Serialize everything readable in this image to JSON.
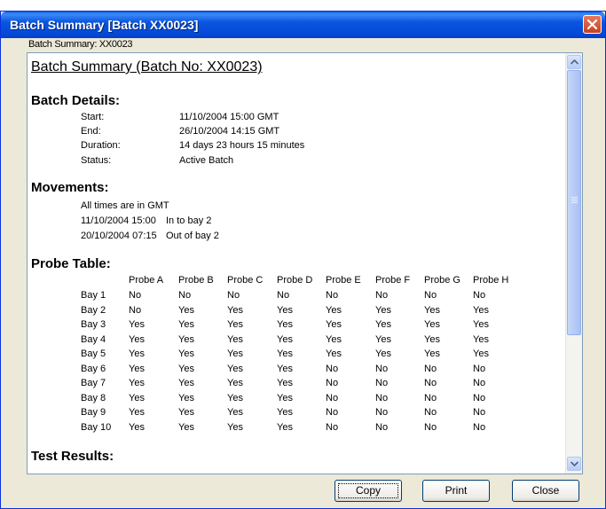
{
  "window": {
    "title": "Batch Summary [Batch XX0023]"
  },
  "group_label": "Batch Summary: XX0023",
  "report": {
    "heading": "Batch Summary (Batch No: XX0023)",
    "batch_details": {
      "title": "Batch Details:",
      "rows": [
        {
          "label": "Start:",
          "value": "11/10/2004 15:00 GMT"
        },
        {
          "label": "End:",
          "value": "26/10/2004 14:15 GMT"
        },
        {
          "label": "Duration:",
          "value": "14 days 23 hours 15 minutes"
        },
        {
          "label": "Status:",
          "value": "Active Batch"
        }
      ]
    },
    "movements": {
      "title": "Movements:",
      "note": "All times are in GMT",
      "rows": [
        {
          "time": "11/10/2004 15:00",
          "event": "In to bay 2"
        },
        {
          "time": "20/10/2004 07:15",
          "event": "Out of bay 2"
        }
      ]
    },
    "probe_table": {
      "title": "Probe Table:",
      "columns": [
        "Probe A",
        "Probe B",
        "Probe C",
        "Probe D",
        "Probe E",
        "Probe F",
        "Probe G",
        "Probe H"
      ],
      "rows": [
        {
          "bay": "Bay 1",
          "cells": [
            "No",
            "No",
            "No",
            "No",
            "No",
            "No",
            "No",
            "No"
          ]
        },
        {
          "bay": "Bay 2",
          "cells": [
            "No",
            "Yes",
            "Yes",
            "Yes",
            "Yes",
            "Yes",
            "Yes",
            "Yes"
          ]
        },
        {
          "bay": "Bay 3",
          "cells": [
            "Yes",
            "Yes",
            "Yes",
            "Yes",
            "Yes",
            "Yes",
            "Yes",
            "Yes"
          ]
        },
        {
          "bay": "Bay 4",
          "cells": [
            "Yes",
            "Yes",
            "Yes",
            "Yes",
            "Yes",
            "Yes",
            "Yes",
            "Yes"
          ]
        },
        {
          "bay": "Bay 5",
          "cells": [
            "Yes",
            "Yes",
            "Yes",
            "Yes",
            "Yes",
            "Yes",
            "Yes",
            "Yes"
          ]
        },
        {
          "bay": "Bay 6",
          "cells": [
            "Yes",
            "Yes",
            "Yes",
            "Yes",
            "No",
            "No",
            "No",
            "No"
          ]
        },
        {
          "bay": "Bay 7",
          "cells": [
            "Yes",
            "Yes",
            "Yes",
            "Yes",
            "No",
            "No",
            "No",
            "No"
          ]
        },
        {
          "bay": "Bay 8",
          "cells": [
            "Yes",
            "Yes",
            "Yes",
            "Yes",
            "No",
            "No",
            "No",
            "No"
          ]
        },
        {
          "bay": "Bay 9",
          "cells": [
            "Yes",
            "Yes",
            "Yes",
            "Yes",
            "No",
            "No",
            "No",
            "No"
          ]
        },
        {
          "bay": "Bay 10",
          "cells": [
            "Yes",
            "Yes",
            "Yes",
            "Yes",
            "No",
            "No",
            "No",
            "No"
          ]
        }
      ]
    },
    "test_results": {
      "title": "Test Results:"
    }
  },
  "buttons": {
    "copy": "Copy",
    "print": "Print",
    "close": "Close"
  },
  "icons": {
    "close": "close-icon",
    "scroll_up": "arrow-up-icon",
    "scroll_down": "arrow-down-icon"
  },
  "colors": {
    "titlebar": "#0a55e0",
    "close_button": "#d9542f",
    "window_bg": "#ece9d8"
  }
}
